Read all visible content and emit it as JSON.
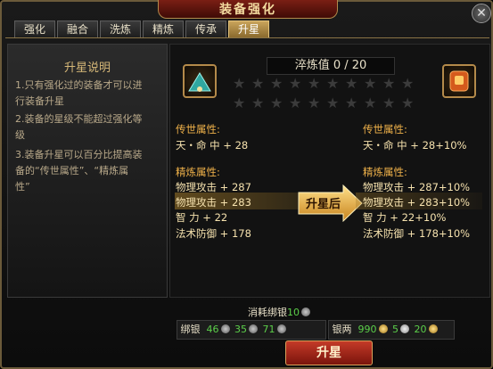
{
  "window": {
    "title": "装备强化"
  },
  "tabs": [
    {
      "label": "强化"
    },
    {
      "label": "融合"
    },
    {
      "label": "洗炼"
    },
    {
      "label": "精炼"
    },
    {
      "label": "传承"
    },
    {
      "label": "升星"
    }
  ],
  "active_tab": "升星",
  "left": {
    "title": "升星说明",
    "lines": [
      "1.只有强化过的装备才可以进",
      "行装备升星",
      "2.装备的星级不能超过强化等",
      "级",
      "3.装备升星可以百分比提高装",
      "备的“传世属性”、“精炼属",
      "性”"
    ]
  },
  "refine": {
    "label": "淬炼值 0 / 20"
  },
  "stars": {
    "total": 20,
    "filled": 0
  },
  "before": {
    "legend_header": "传世属性:",
    "legend": [
      "天・命 中 + 28"
    ],
    "refine_header": "精炼属性:",
    "refine_attrs": [
      "物理攻击 + 287",
      "物理攻击 + 283",
      "智 力 + 22",
      "法术防御 + 178"
    ]
  },
  "after": {
    "legend_header": "传世属性:",
    "legend": [
      "天・命 中 + 28+10%"
    ],
    "refine_header": "精炼属性:",
    "refine_attrs": [
      "物理攻击 + 287+10%",
      "物理攻击 + 283+10%",
      "智 力 + 22+10%",
      "法术防御 + 178+10%"
    ]
  },
  "arrow_label": "升星后",
  "cost": {
    "label": "消耗绑银",
    "value": "10"
  },
  "bound_silver": {
    "label": "绑银",
    "gold": "46",
    "silver": "35",
    "copper": "71"
  },
  "silver": {
    "label": "银两",
    "gold": "990",
    "silver": "5",
    "copper": "20"
  },
  "button": {
    "label": "升星"
  },
  "colors": {
    "accent": "#f0b24a",
    "button": "#c43a28",
    "tab_active": "#c9a45b"
  }
}
